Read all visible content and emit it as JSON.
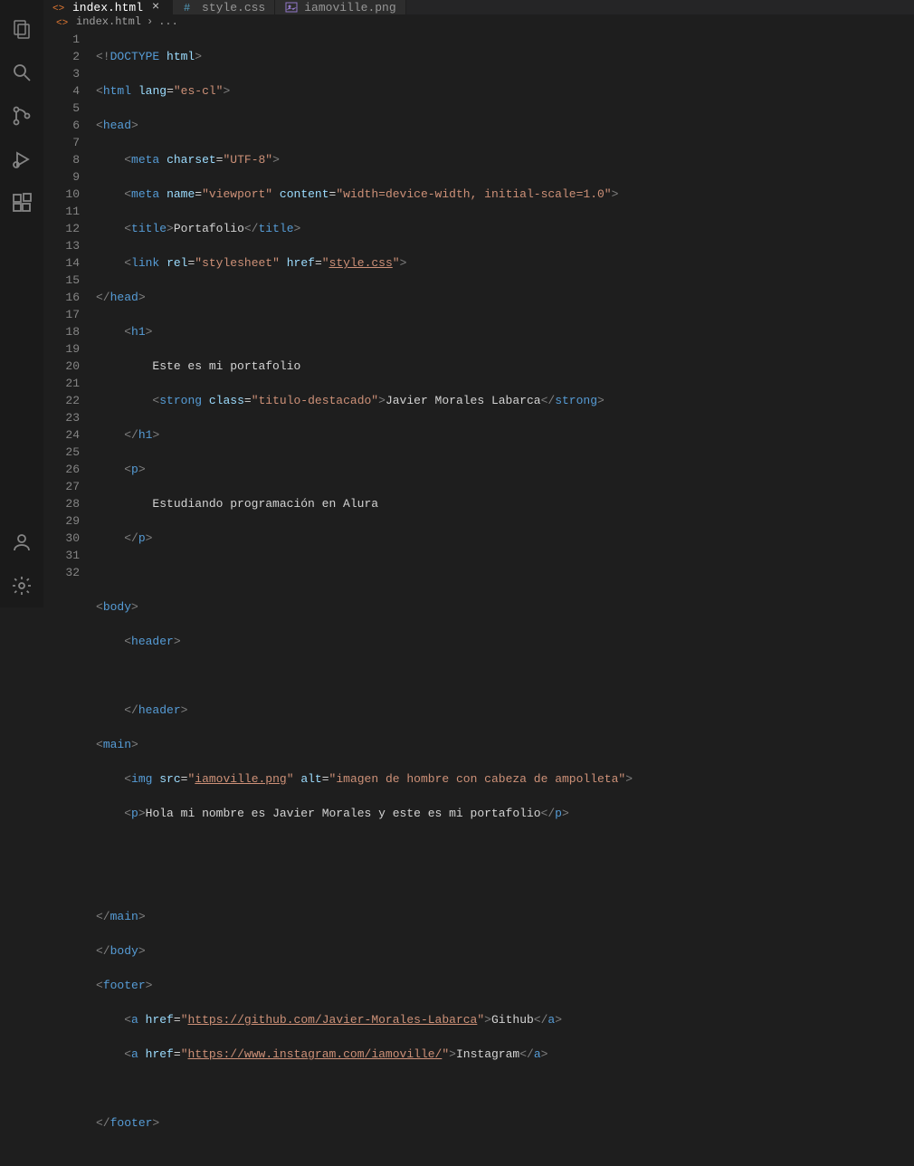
{
  "activity": {
    "items": [
      "explorer",
      "search",
      "source-control",
      "run-debug",
      "extensions"
    ],
    "bottom": [
      "accounts",
      "settings"
    ]
  },
  "tabs": [
    {
      "icon": "html",
      "label": "index.html",
      "active": true,
      "close": true
    },
    {
      "icon": "css",
      "label": "style.css",
      "active": false,
      "close": false
    },
    {
      "icon": "image",
      "label": "iamoville.png",
      "active": false,
      "close": false
    }
  ],
  "breadcrumb": {
    "icon": "html",
    "file": "index.html",
    "sep": "›",
    "ellipsis": "..."
  },
  "lines": [
    "1",
    "2",
    "3",
    "4",
    "5",
    "6",
    "7",
    "8",
    "9",
    "10",
    "11",
    "12",
    "13",
    "14",
    "15",
    "16",
    "17",
    "18",
    "19",
    "20",
    "21",
    "22",
    "23",
    "24",
    "25",
    "26",
    "27",
    "28",
    "29",
    "30",
    "31",
    "32"
  ],
  "code": {
    "l1": {
      "open": "<!",
      "doctype": "DOCTYPE",
      "space": " ",
      "html": "html",
      "close": ">"
    },
    "l2": {
      "open": "<",
      "tag": "html",
      "space": " ",
      "attr": "lang",
      "eq": "=",
      "val": "\"es-cl\"",
      "close": ">"
    },
    "l3": {
      "open": "<",
      "tag": "head",
      "close": ">"
    },
    "l4": {
      "open": "<",
      "tag": "meta",
      "space": " ",
      "attr": "charset",
      "eq": "=",
      "val": "\"UTF-8\"",
      "close": ">"
    },
    "l5": {
      "open": "<",
      "tag": "meta",
      "space": " ",
      "attr1": "name",
      "eq": "=",
      "val1": "\"viewport\"",
      "space2": " ",
      "attr2": "content",
      "val2": "\"width=device-width, initial-scale=1.0\"",
      "close": ">"
    },
    "l6": {
      "open": "<",
      "tag": "title",
      "close": ">",
      "text": "Portafolio",
      "open2": "</",
      "tag2": "title",
      "close2": ">"
    },
    "l7": {
      "open": "<",
      "tag": "link",
      "space": " ",
      "attr1": "rel",
      "eq": "=",
      "val1": "\"stylesheet\"",
      "space2": " ",
      "attr2": "href",
      "val2a": "\"",
      "val2b": "style.css",
      "val2c": "\"",
      "close": ">"
    },
    "l8": {
      "open": "</",
      "tag": "head",
      "close": ">"
    },
    "l9": {
      "open": "<",
      "tag": "h1",
      "close": ">"
    },
    "l10": {
      "text": "Este es mi portafolio"
    },
    "l11": {
      "open": "<",
      "tag": "strong",
      "space": " ",
      "attr": "class",
      "eq": "=",
      "val": "\"titulo-destacado\"",
      "close": ">",
      "text": "Javier Morales Labarca",
      "open2": "</",
      "tag2": "strong",
      "close2": ">"
    },
    "l12": {
      "open": "</",
      "tag": "h1",
      "close": ">"
    },
    "l13": {
      "open": "<",
      "tag": "p",
      "close": ">"
    },
    "l14": {
      "text": "Estudiando programación en Alura"
    },
    "l15": {
      "open": "</",
      "tag": "p",
      "close": ">"
    },
    "l17": {
      "open": "<",
      "tag": "body",
      "close": ">"
    },
    "l18": {
      "open": "<",
      "tag": "header",
      "close": ">"
    },
    "l20": {
      "open": "</",
      "tag": "header",
      "close": ">"
    },
    "l21": {
      "open": "<",
      "tag": "main",
      "close": ">"
    },
    "l22": {
      "open": "<",
      "tag": "img",
      "space": " ",
      "attr1": "src",
      "eq": "=",
      "val1a": "\"",
      "val1b": "iamoville.png",
      "val1c": "\"",
      "space2": " ",
      "attr2": "alt",
      "val2": "\"imagen de hombre con cabeza de ampolleta\"",
      "close": ">"
    },
    "l23": {
      "open": "<",
      "tag": "p",
      "close": ">",
      "text": "Hola mi nombre es Javier Morales y este es mi portafolio",
      "open2": "</",
      "tag2": "p",
      "close2": ">"
    },
    "l26": {
      "open": "</",
      "tag": "main",
      "close": ">"
    },
    "l27": {
      "open": "</",
      "tag": "body",
      "close": ">"
    },
    "l28": {
      "open": "<",
      "tag": "footer",
      "close": ">"
    },
    "l29": {
      "open": "<",
      "tag": "a",
      "space": " ",
      "attr": "href",
      "eq": "=",
      "vala": "\"",
      "valb": "https://github.com/Javier-Morales-Labarca",
      "valc": "\"",
      "close": ">",
      "text": "Github",
      "open2": "</",
      "tag2": "a",
      "close2": ">"
    },
    "l30": {
      "open": "<",
      "tag": "a",
      "space": " ",
      "attr": "href",
      "eq": "=",
      "vala": "\"",
      "valb": "https://www.instagram.com/iamoville/",
      "valc": "\"",
      "close": ">",
      "text": "Instagram",
      "open2": "</",
      "tag2": "a",
      "close2": ">"
    },
    "l32": {
      "open": "</",
      "tag": "footer",
      "close": ">"
    }
  }
}
